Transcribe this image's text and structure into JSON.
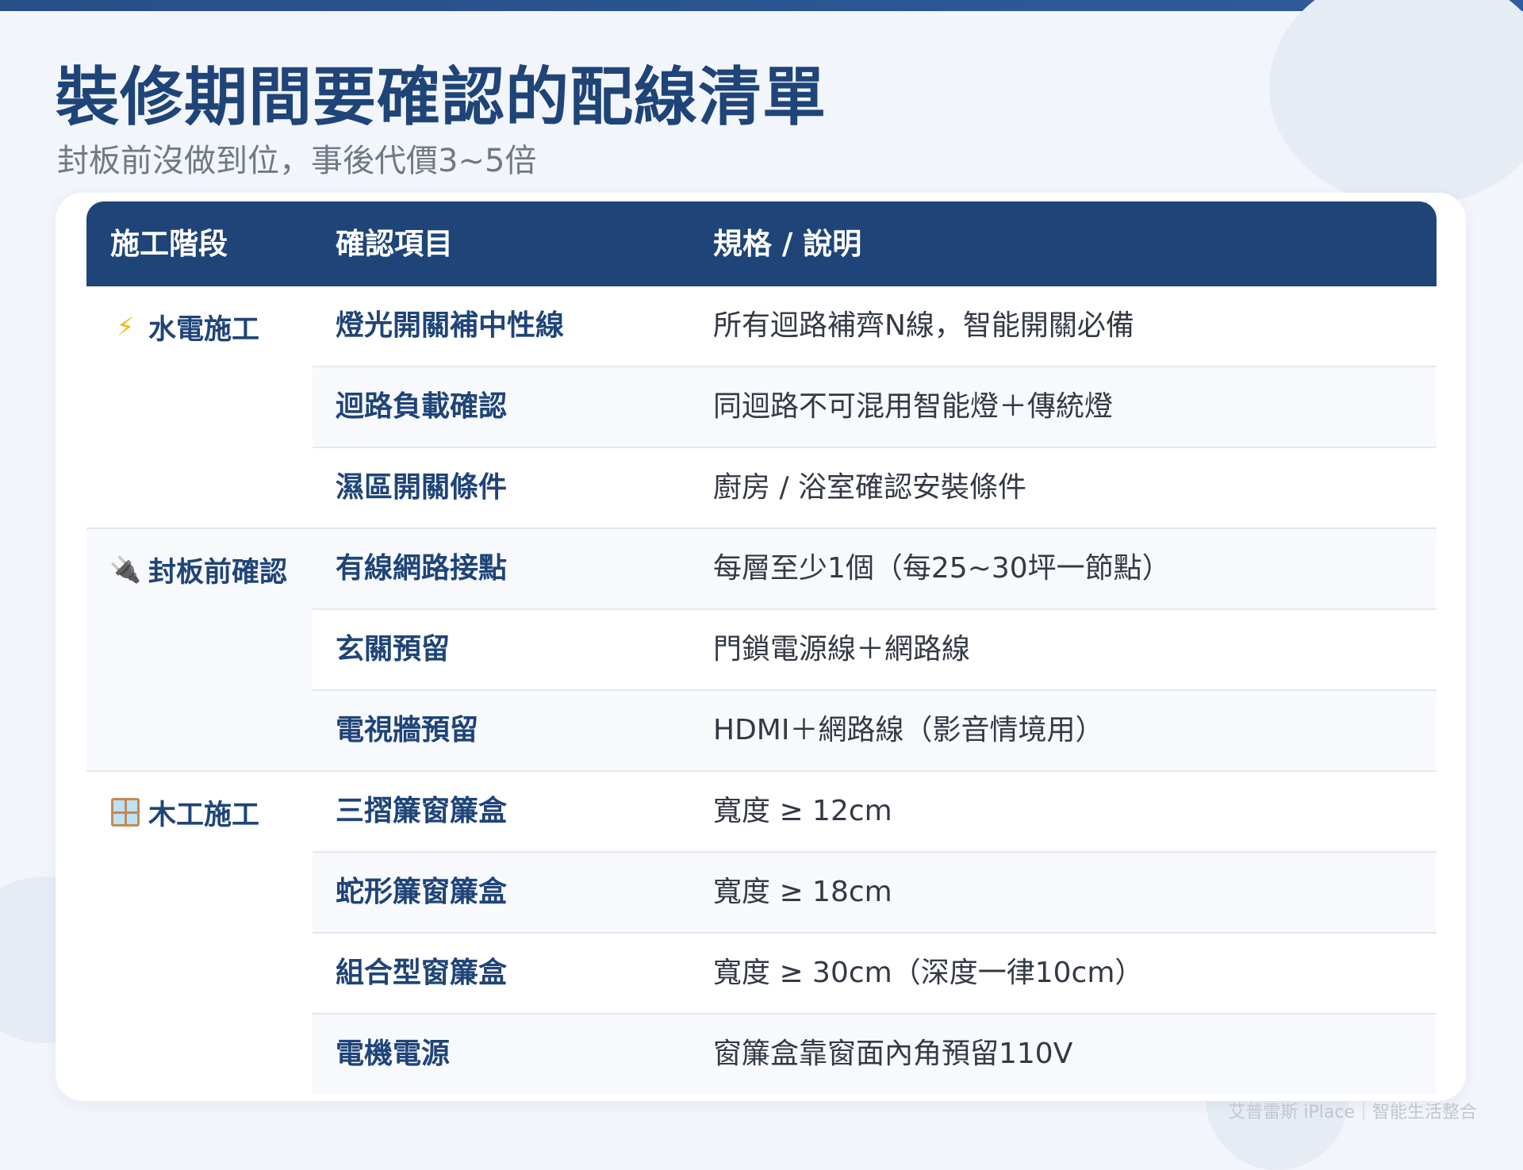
{
  "title": "裝修期間要確認的配線清單",
  "subtitle": "封板前沒做到位，事後代價3~5倍",
  "table": {
    "headers": {
      "stage": "施工階段",
      "item": "確認項目",
      "spec": "規格 / 說明"
    },
    "groups": [
      {
        "stage": "水電施工",
        "icon": "lightning-bolt-icon",
        "icon_glyph": "⚡",
        "rows": [
          {
            "item": "燈光開關補中性線",
            "spec": "所有迴路補齊N線，智能開關必備"
          },
          {
            "item": "迴路負載確認",
            "spec": "同迴路不可混用智能燈＋傳統燈"
          },
          {
            "item": "濕區開關條件",
            "spec": "廚房 / 浴室確認安裝條件"
          }
        ]
      },
      {
        "stage": "封板前確認",
        "icon": "electric-plug-icon",
        "icon_glyph": "🔌",
        "rows": [
          {
            "item": "有線網路接點",
            "spec": "每層至少1個（每25~30坪一節點）"
          },
          {
            "item": "玄關預留",
            "spec": "門鎖電源線＋網路線"
          },
          {
            "item": "電視牆預留",
            "spec": "HDMI＋網路線（影音情境用）"
          }
        ]
      },
      {
        "stage": "木工施工",
        "icon": "window-icon",
        "rows": [
          {
            "item": "三摺簾窗簾盒",
            "spec": "寬度 ≥ 12cm"
          },
          {
            "item": "蛇形簾窗簾盒",
            "spec": "寬度 ≥ 18cm"
          },
          {
            "item": "組合型窗簾盒",
            "spec": "寬度 ≥ 30cm（深度一律10cm）"
          },
          {
            "item": "電機電源",
            "spec": "窗簾盒靠窗面內角預留110V"
          }
        ]
      }
    ]
  },
  "footer": "艾普雷斯 iPlace｜智能生活整合",
  "colors": {
    "primary": "#1f4478",
    "background": "#f2f5fa",
    "row_alt": "#f7f9fc",
    "text": "#333a44",
    "subtitle": "#6f7884"
  }
}
